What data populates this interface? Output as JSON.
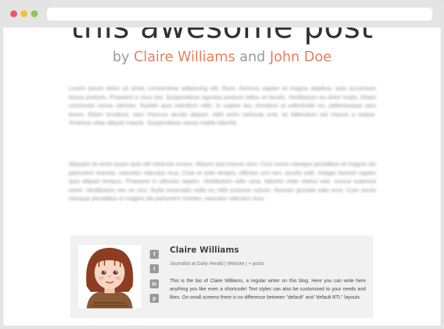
{
  "post": {
    "title": "this awesome post",
    "byline_prefix": "by",
    "author_1": "Claire Williams",
    "byline_and": "and",
    "author_2": "John Doe"
  },
  "content": {
    "paragraph_1": "Lorem ipsum dolor sit amet, consectetur adipiscing elit. Nunc rhoncus sapien et magna dapibus, quis accumsan lectus pretium. Praesent a risus dui. Suspendisse egestas pretium tellus et iaculis. Vestibulum eu dolor turpis. Etiam commodo varius ultricies. Nullam quis interdum nibh. In sapien leo, tincidunt ut sollicitudin eu, pellentesque quis lorem. Etiam tincidunt, sem rhoncus iaculis aliquet, nibh enim vehicula erat, ac bibendum est mauris a neque. Vivamus vitae aliquet mauris. Suspendisse varius mattis lobortis.",
    "paragraph_2": "Aliquam sit amet quam quis elit vehicula ornare. Mauris sed mauris sem. Cum sociis natoque penatibus et magnis dis parturient montes, nascetur ridiculus mus. Cras et ante tempor, efficitur orci nec, iaculis velit. Integer laoreet sapien quis aliquet tempus. Praesent in ultricies sapien. Vestibulum odio urna, lobortis vitae metus sed, cursus euismod tortor. Vestibulum nec ex orci. Nulla venenatis nulla eu nibh pulvinar rutrum. Aenean gravida odio eros. Cum sociis natoque penatibus et magnis dis parturient montes, nascetur ridiculus mus."
  },
  "author_box": {
    "name": "Claire Williams",
    "meta": "Journalist at Daily Herald | Website | + posts",
    "bio": "This is the bio of Claire Williams, a regular writer on this blog. Here you can write here anything you like even a shortcode! Text styles can also be customized to your needs and likes. On small screens there is no difference between \"default\" and \"default RTL\" layouts.",
    "social": [
      {
        "icon": "facebook-icon",
        "glyph": "f"
      },
      {
        "icon": "twitter-icon",
        "glyph": "t"
      },
      {
        "icon": "linkedin-icon",
        "glyph": "in"
      },
      {
        "icon": "pinterest-icon",
        "glyph": "p"
      }
    ]
  },
  "colors": {
    "accent": "#e8805c",
    "box_bg": "#f1f1f1",
    "icon_bg": "#999999"
  }
}
